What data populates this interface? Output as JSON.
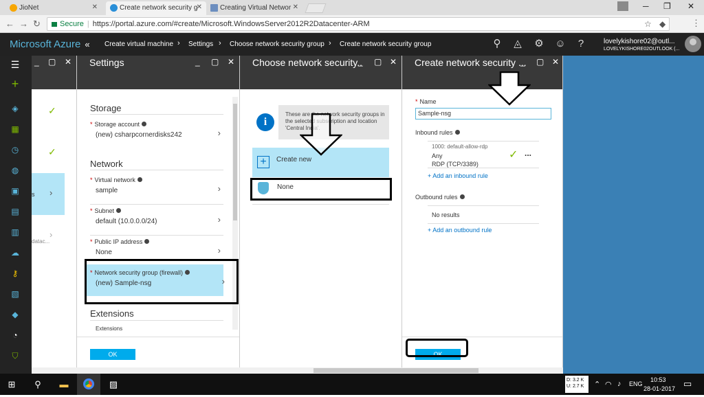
{
  "browser": {
    "tabs": [
      {
        "label": "JioNet",
        "icon": "jio-icon",
        "color": "#f7a600"
      },
      {
        "label": "Create network security g",
        "icon": "azure-cloud-icon",
        "color": "#2a8fd8"
      },
      {
        "label": "Creating Virtual Networ",
        "icon": "page-icon",
        "color": "#6c8ebf"
      }
    ],
    "address": {
      "secure_label": "Secure",
      "separator": "|",
      "url": "https://portal.azure.com/#create/Microsoft.WindowsServer2012R2Datacenter-ARM"
    }
  },
  "azure": {
    "brand": "Microsoft Azure",
    "collapse": "«",
    "breadcrumbs": [
      "Create virtual machine",
      "Settings",
      "Choose network security group",
      "Create network security group"
    ],
    "user_line1": "lovelykishore02@outl...",
    "user_line2": "LOVELYKISHORE02OUTLOOK (..."
  },
  "blade_partial": {
    "fragment_s": "s",
    "fragment_datac": "datac..."
  },
  "settings": {
    "title": "Settings",
    "storage_heading": "Storage",
    "storage_account_label": "Storage account",
    "storage_account_value": "(new) csharpcornerdisks242",
    "network_heading": "Network",
    "vnet_label": "Virtual network",
    "vnet_value": "sample",
    "subnet_label": "Subnet",
    "subnet_value": "default (10.0.0.0/24)",
    "public_ip_label": "Public IP address",
    "public_ip_value": "None",
    "nsg_label": "Network security group (firewall)",
    "nsg_value": "(new) Sample-nsg",
    "extensions_heading": "Extensions",
    "extensions_field": "Extensions",
    "ok": "OK"
  },
  "choose": {
    "title": "Choose network security..",
    "info_text": "These are the network security groups in the selected subscription and location 'Central India'.",
    "create_new": "Create new",
    "none": "None"
  },
  "create": {
    "title": "Create network security ...",
    "name_label": "Name",
    "name_value": "Sample-nsg",
    "inbound_label": "Inbound rules",
    "rule_name": "1000: default-allow-rdp",
    "rule_source": "Any",
    "rule_port": "RDP (TCP/3389)",
    "rule_more": "...",
    "add_inbound": "+ Add an inbound rule",
    "outbound_label": "Outbound rules",
    "no_results": "No results",
    "add_outbound": "+ Add an outbound rule",
    "ok": "OK"
  },
  "taskbar": {
    "net_down": "D: 3.2 K",
    "net_up": "U: 2.7 K",
    "lang": "ENG",
    "time": "10:53",
    "date": "28-01-2017"
  },
  "colors": {
    "azure_blue": "#00abec",
    "link": "#0072c6",
    "check_green": "#7fba00",
    "header_dark": "#222222",
    "blade_header": "#393939"
  }
}
